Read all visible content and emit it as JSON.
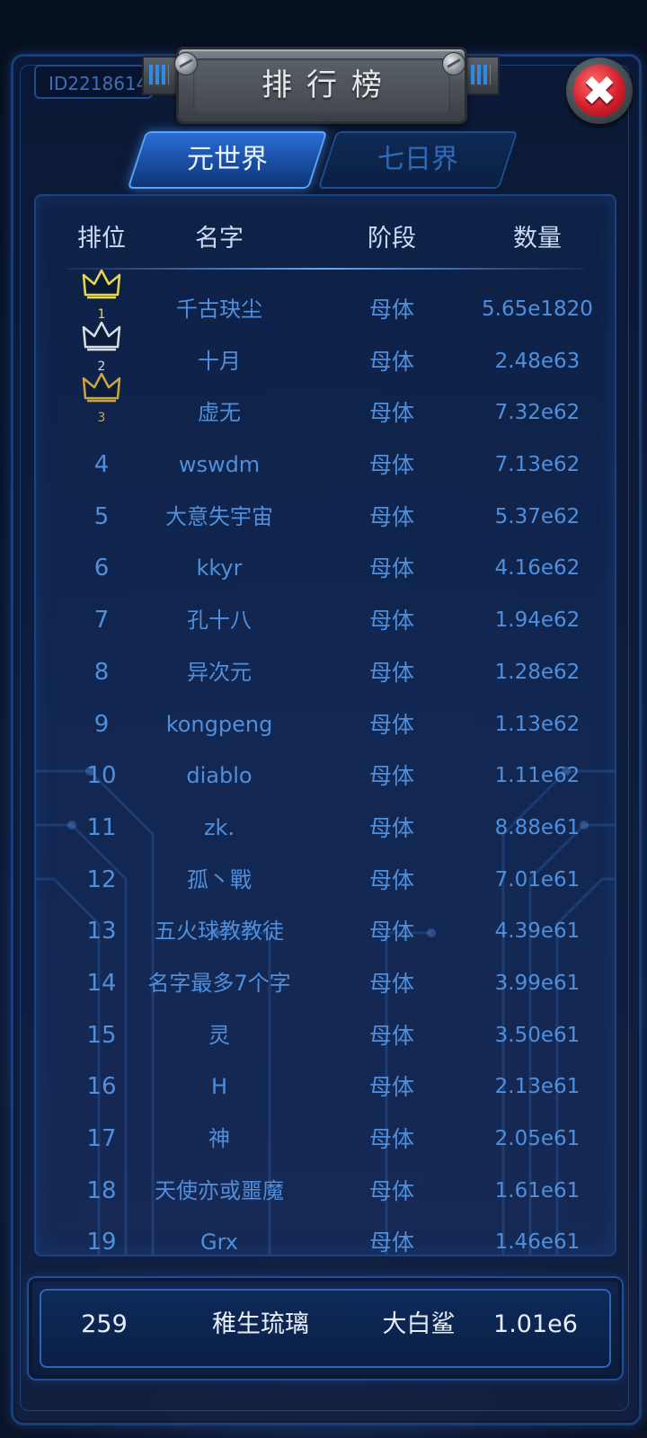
{
  "player_id": "ID2218614",
  "title": "排行榜",
  "close_symbol": "✖",
  "tabs": [
    {
      "label": "元世界",
      "active": true
    },
    {
      "label": "七日界",
      "active": false
    }
  ],
  "table": {
    "headers": {
      "rank": "排位",
      "name": "名字",
      "stage": "阶段",
      "quantity": "数量"
    },
    "rows": [
      {
        "rank": "1",
        "name": "千古玦尘",
        "stage": "母体",
        "quantity": "5.65e1820",
        "crown": "gold"
      },
      {
        "rank": "2",
        "name": "十月",
        "stage": "母体",
        "quantity": "2.48e63",
        "crown": "silver"
      },
      {
        "rank": "3",
        "name": "虚无",
        "stage": "母体",
        "quantity": "7.32e62",
        "crown": "bronze"
      },
      {
        "rank": "4",
        "name": "wswdm",
        "stage": "母体",
        "quantity": "7.13e62"
      },
      {
        "rank": "5",
        "name": "大意失宇宙",
        "stage": "母体",
        "quantity": "5.37e62"
      },
      {
        "rank": "6",
        "name": "kkyr",
        "stage": "母体",
        "quantity": "4.16e62"
      },
      {
        "rank": "7",
        "name": "孔十八",
        "stage": "母体",
        "quantity": "1.94e62"
      },
      {
        "rank": "8",
        "name": "异次元",
        "stage": "母体",
        "quantity": "1.28e62"
      },
      {
        "rank": "9",
        "name": "kongpeng",
        "stage": "母体",
        "quantity": "1.13e62"
      },
      {
        "rank": "10",
        "name": "diablo",
        "stage": "母体",
        "quantity": "1.11e62"
      },
      {
        "rank": "11",
        "name": "zk.",
        "stage": "母体",
        "quantity": "8.88e61"
      },
      {
        "rank": "12",
        "name": "孤丶戰",
        "stage": "母体",
        "quantity": "7.01e61"
      },
      {
        "rank": "13",
        "name": "五火球教教徒",
        "stage": "母体",
        "quantity": "4.39e61"
      },
      {
        "rank": "14",
        "name": "名字最多7个字",
        "stage": "母体",
        "quantity": "3.99e61"
      },
      {
        "rank": "15",
        "name": "灵",
        "stage": "母体",
        "quantity": "3.50e61"
      },
      {
        "rank": "16",
        "name": "H",
        "stage": "母体",
        "quantity": "2.13e61"
      },
      {
        "rank": "17",
        "name": "神",
        "stage": "母体",
        "quantity": "2.05e61"
      },
      {
        "rank": "18",
        "name": "天使亦或噩魔",
        "stage": "母体",
        "quantity": "1.61e61"
      },
      {
        "rank": "19",
        "name": "Grx",
        "stage": "母体",
        "quantity": "1.46e61"
      }
    ]
  },
  "self_entry": {
    "rank": "259",
    "name": "稚生琉璃",
    "stage": "大白鲨",
    "quantity": "1.01e6"
  },
  "colors": {
    "accent_blue": "#4f8fdc",
    "header_text": "#c9dcf3",
    "gold_crown": "#e8d84a",
    "silver_crown": "#d8dde4",
    "bronze_crown": "#c9a640",
    "close_red": "#d41f2c"
  }
}
